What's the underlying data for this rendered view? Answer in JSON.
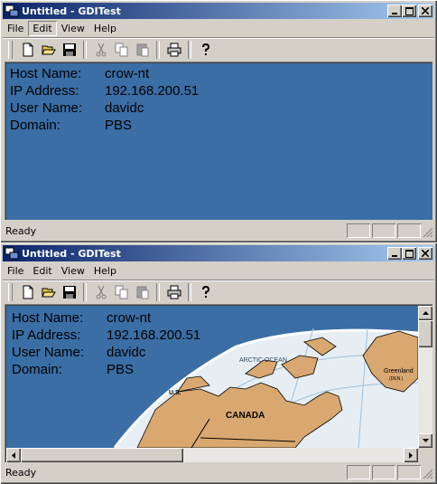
{
  "windows": [
    {
      "title": "Untitled - GDITest",
      "menu": [
        "File",
        "Edit",
        "View",
        "Help"
      ],
      "open_menu": "Edit",
      "info": [
        {
          "label": "Host Name:",
          "value": "crow-nt"
        },
        {
          "label": "IP Address:",
          "value": "192.168.200.51"
        },
        {
          "label": "User Name:",
          "value": "davidc"
        },
        {
          "label": "Domain:",
          "value": "PBS"
        }
      ],
      "status": "Ready"
    },
    {
      "title": "Untitled - GDITest",
      "menu": [
        "File",
        "Edit",
        "View",
        "Help"
      ],
      "info": [
        {
          "label": "Host Name:",
          "value": "crow-nt"
        },
        {
          "label": "IP Address:",
          "value": "192.168.200.51"
        },
        {
          "label": "User Name:",
          "value": "davidc"
        },
        {
          "label": "Domain:",
          "value": "PBS"
        }
      ],
      "map_labels": {
        "arctic": "ARCTIC OCEAN",
        "greenland": "Greenland",
        "greenland_sub": "(DEN.)",
        "us": "U.S.",
        "canada": "CANADA"
      },
      "status": "Ready"
    }
  ],
  "toolbar_icons": [
    "new-icon",
    "open-icon",
    "save-icon",
    "cut-icon",
    "copy-icon",
    "paste-icon",
    "print-icon",
    "help-icon"
  ],
  "colors": {
    "client_bg": "#3a6ea5",
    "title_start": "#0a246a",
    "title_end": "#a6caf0",
    "face": "#d4d0c8"
  }
}
